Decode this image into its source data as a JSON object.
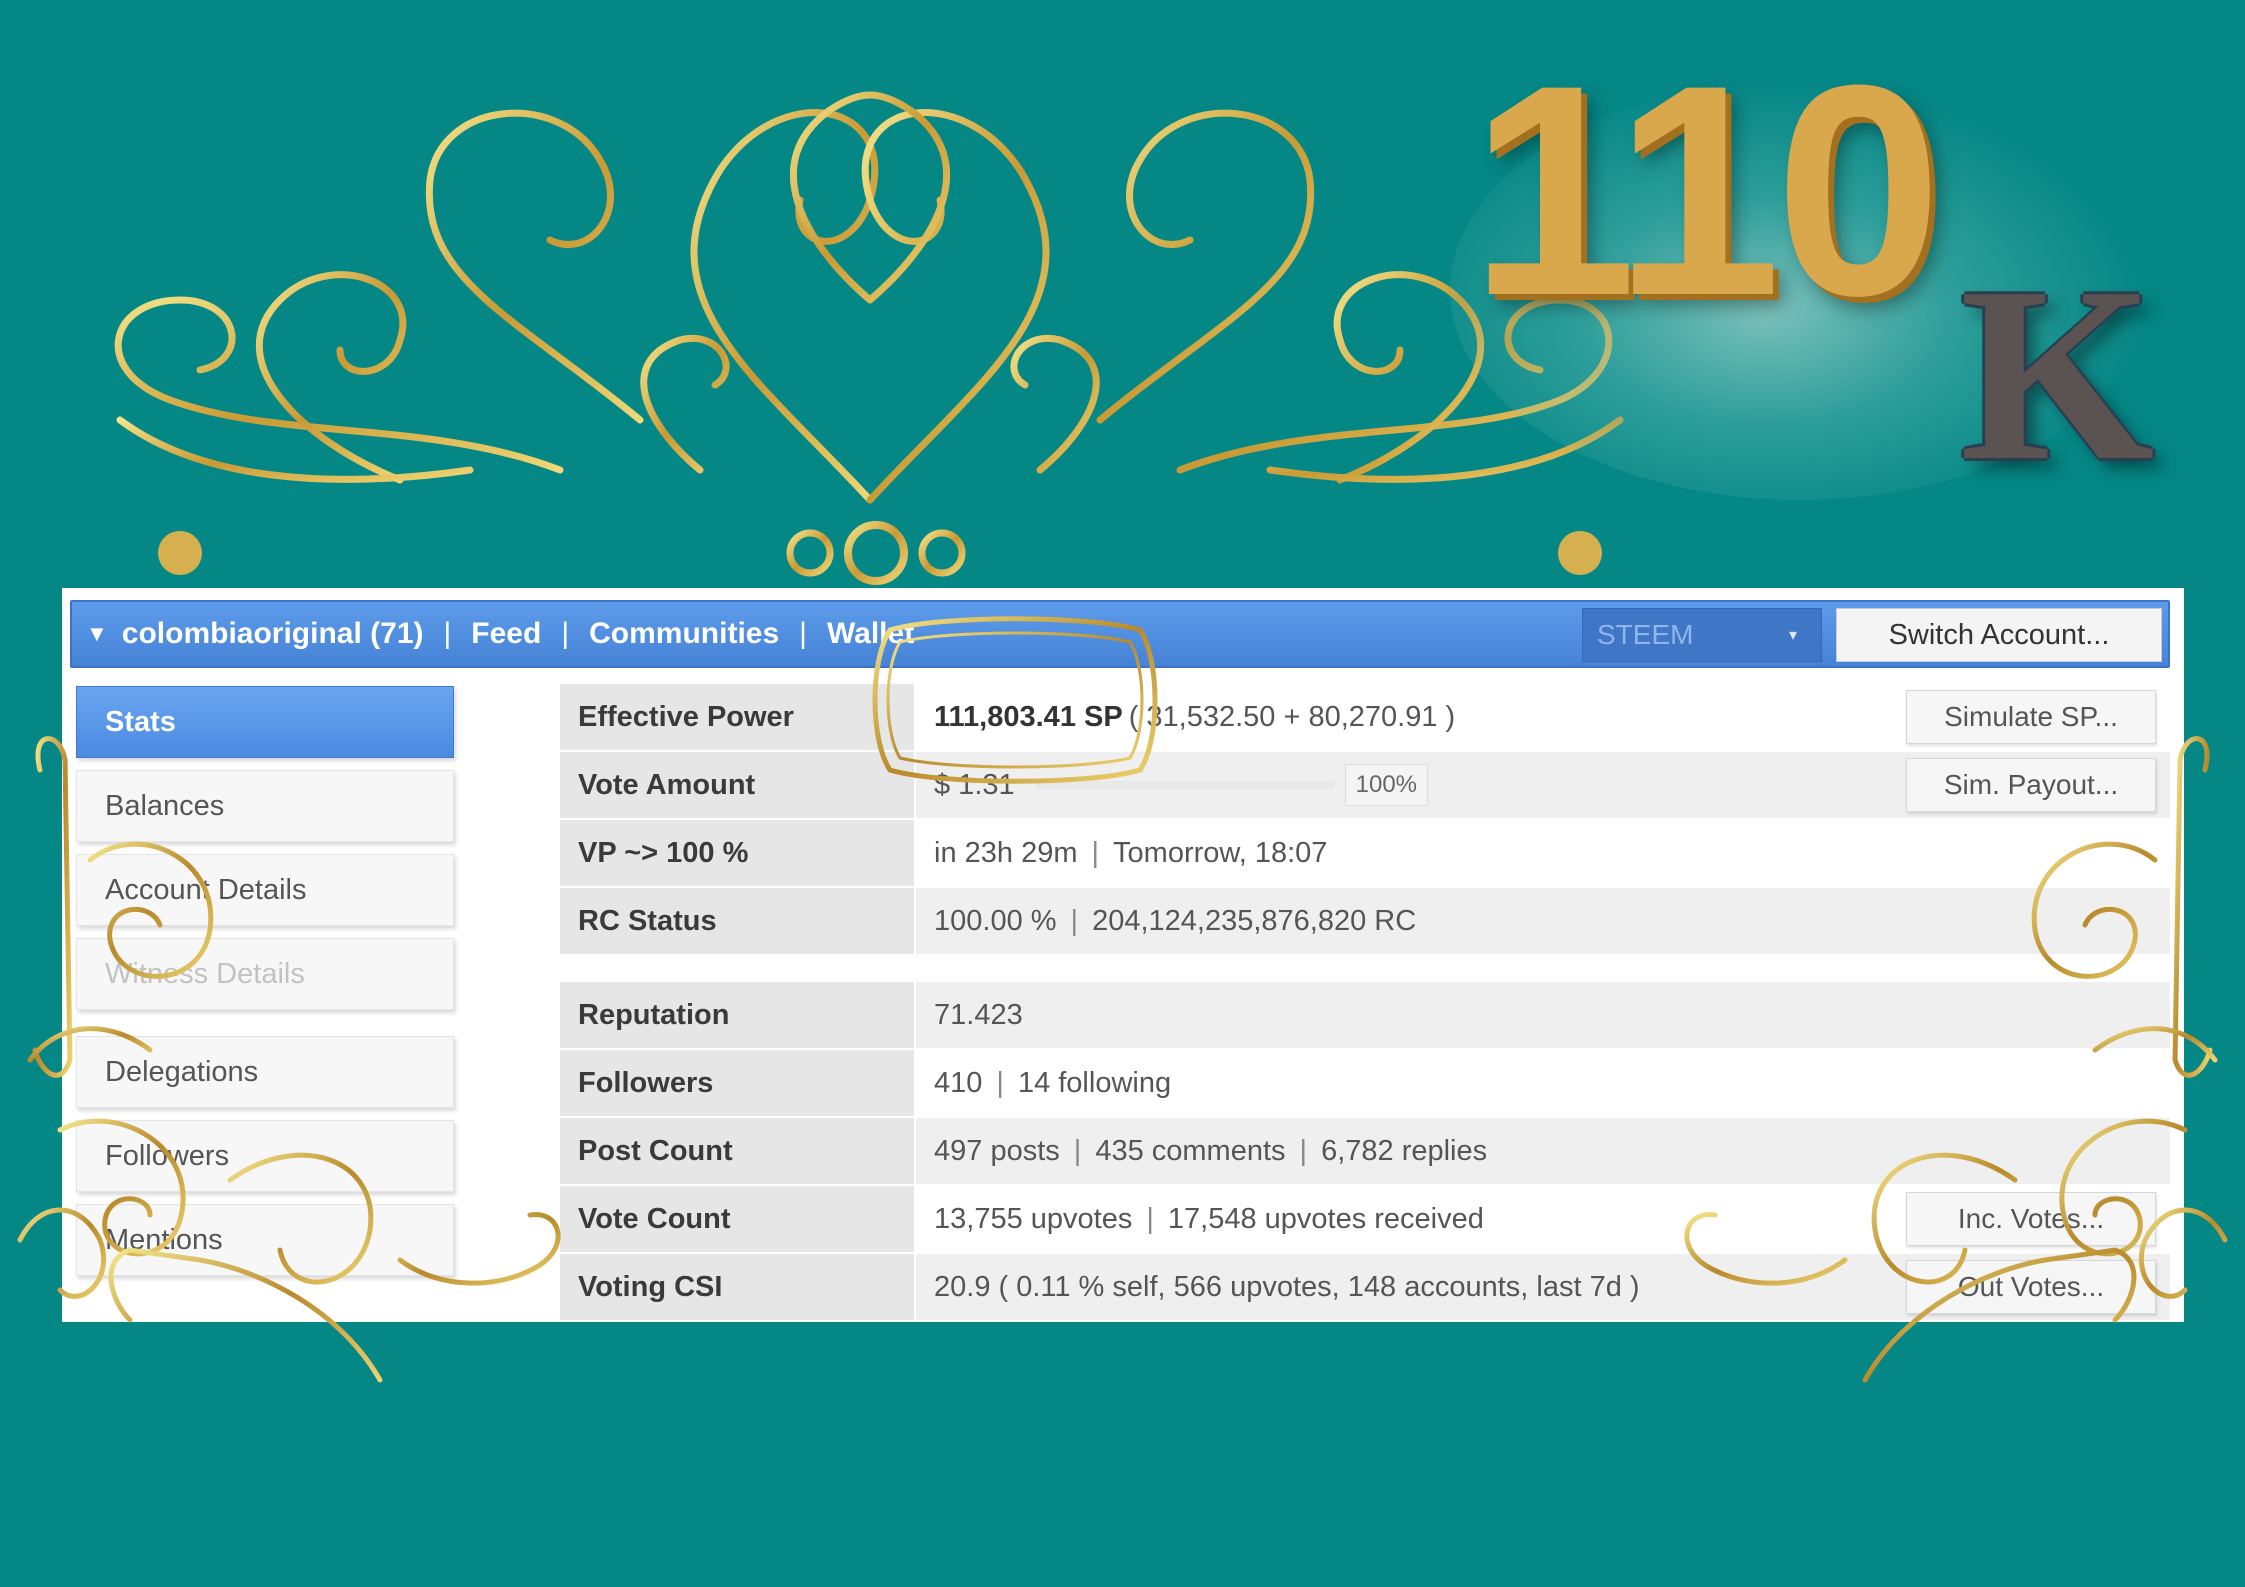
{
  "badge": {
    "number": "110",
    "suffix": "K"
  },
  "topbar": {
    "account": "colombiaoriginal (71)",
    "nav": [
      "Feed",
      "Communities",
      "Wallet"
    ],
    "currency_select": "STEEM",
    "switch_account": "Switch Account..."
  },
  "sidebar": {
    "items": [
      {
        "label": "Stats",
        "state": "active"
      },
      {
        "label": "Balances",
        "state": "normal"
      },
      {
        "label": "Account Details",
        "state": "normal"
      },
      {
        "label": "Witness Details",
        "state": "disabled"
      },
      {
        "label": "Delegations",
        "state": "normal"
      },
      {
        "label": "Followers",
        "state": "normal"
      },
      {
        "label": "Mentions",
        "state": "normal"
      }
    ]
  },
  "stats": {
    "effective_power": {
      "label": "Effective Power",
      "value": "111,803.41 SP",
      "detail": "( 31,532.50 + 80,270.91 )",
      "action": "Simulate SP..."
    },
    "vote_amount": {
      "label": "Vote Amount",
      "value": "$ 1.31",
      "percent": "100%",
      "action": "Sim. Payout..."
    },
    "vp": {
      "label": "VP ~> 100 %",
      "eta": "in 23h 29m",
      "when": "Tomorrow, 18:07"
    },
    "rc": {
      "label": "RC Status",
      "percent": "100.00 %",
      "amount": "204,124,235,876,820 RC"
    },
    "reputation": {
      "label": "Reputation",
      "value": "71.423"
    },
    "followers": {
      "label": "Followers",
      "count": "410",
      "following": "14 following"
    },
    "post_count": {
      "label": "Post Count",
      "posts": "497 posts",
      "comments": "435 comments",
      "replies": "6,782 replies"
    },
    "vote_count": {
      "label": "Vote Count",
      "upvotes": "13,755 upvotes",
      "received": "17,548 upvotes received",
      "action": "Inc. Votes..."
    },
    "voting_csi": {
      "label": "Voting CSI",
      "value": "20.9 ( 0.11 % self, 566 upvotes, 148 accounts, last 7d )",
      "action": "Out Votes..."
    }
  },
  "colors": {
    "background": "#058786",
    "gold": "#d4b04a",
    "topbar_blue": "#4a88dc",
    "active_blue": "#5a98ea"
  }
}
